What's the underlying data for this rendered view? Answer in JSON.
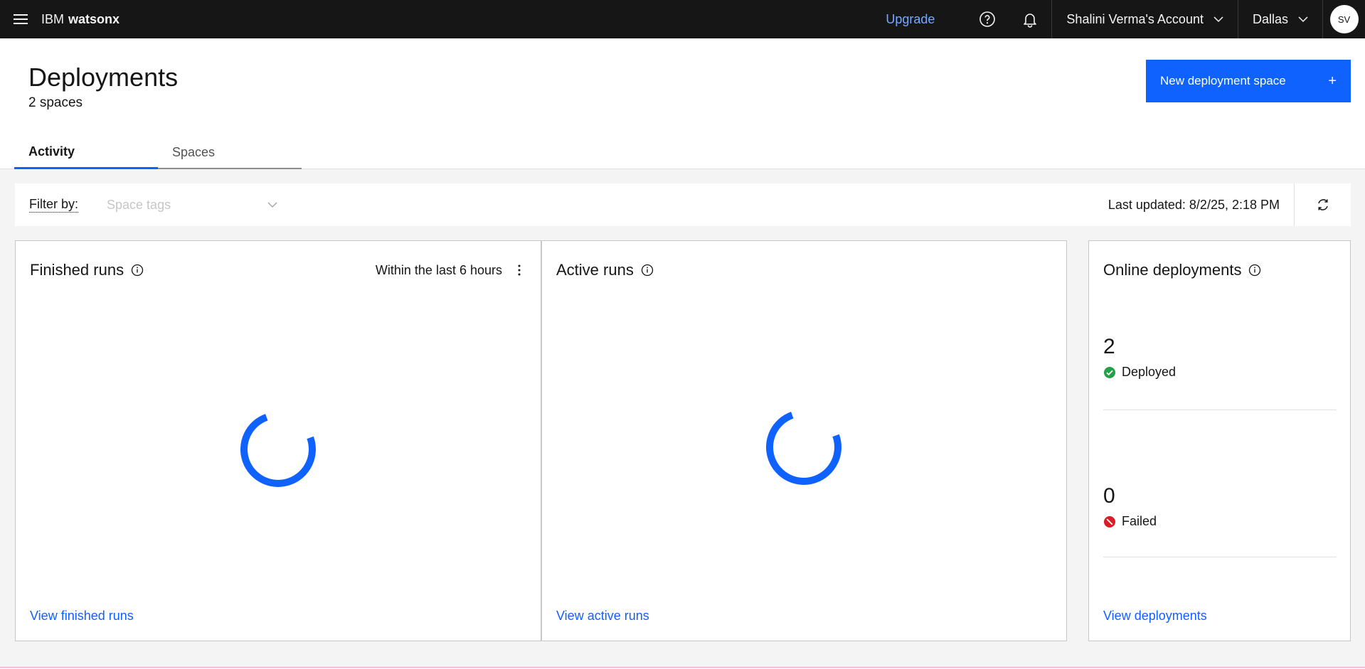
{
  "topbar": {
    "brand_prefix": "IBM",
    "brand_name": "watsonx",
    "upgrade_label": "Upgrade",
    "account_label": "Shalini Verma's Account",
    "region_label": "Dallas",
    "avatar_initials": "SV"
  },
  "header": {
    "title": "Deployments",
    "subtitle": "2 spaces",
    "new_button_label": "New deployment space",
    "tabs": [
      {
        "label": "Activity",
        "active": true
      },
      {
        "label": "Spaces",
        "active": false
      }
    ]
  },
  "filter": {
    "label": "Filter by:",
    "placeholder": "Space tags",
    "last_updated": "Last updated: 8/2/25, 2:18 PM"
  },
  "cards": {
    "finished": {
      "title": "Finished runs",
      "period": "Within the last 6 hours",
      "link": "View finished runs"
    },
    "active": {
      "title": "Active runs",
      "link": "View active runs"
    },
    "online": {
      "title": "Online deployments",
      "deployed_count": "2",
      "deployed_label": "Deployed",
      "failed_count": "0",
      "failed_label": "Failed",
      "link": "View deployments"
    }
  },
  "colors": {
    "accent": "#0f62fe",
    "topbar": "#161616",
    "success": "#24a148",
    "error": "#da1e28",
    "upgrade": "#78a9ff"
  },
  "icons": [
    "hamburger-icon",
    "help-icon",
    "notification-icon",
    "chevron-down-icon",
    "add-icon",
    "refresh-icon",
    "info-icon",
    "overflow-menu-icon",
    "checkmark-filled-icon",
    "error-filled-icon",
    "loading-spinner-icon"
  ]
}
